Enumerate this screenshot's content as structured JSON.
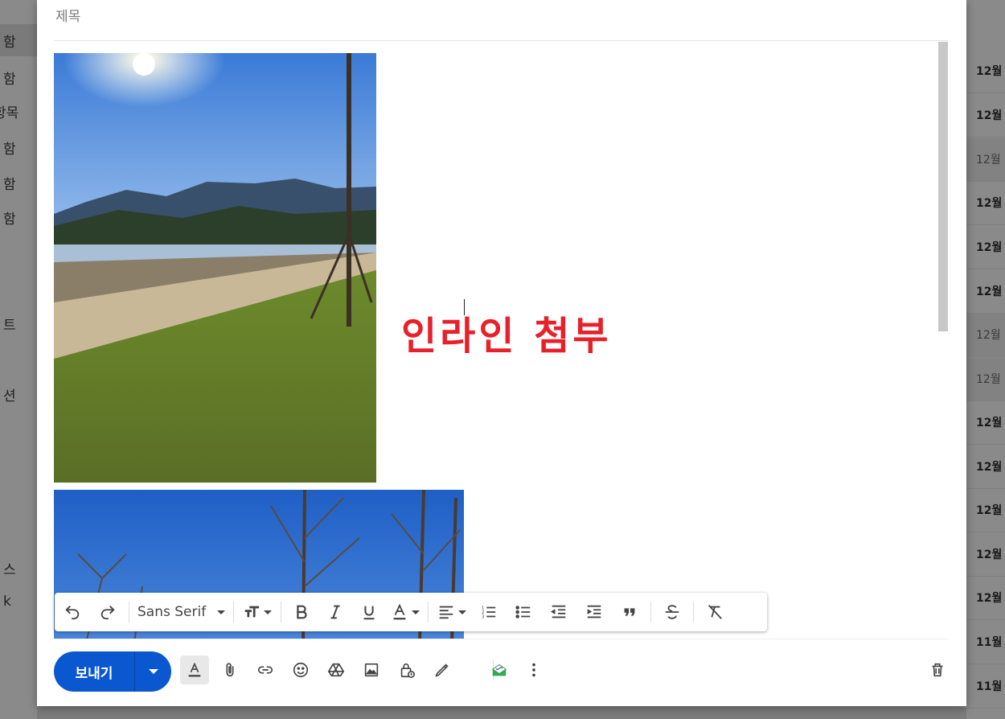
{
  "background": {
    "left_labels": [
      "함",
      "함",
      "항목",
      "함",
      "함",
      "함",
      "트",
      "션",
      "스",
      "k"
    ],
    "right_dates": [
      "12월",
      "12월",
      "12월",
      "12월",
      "12월",
      "12월",
      "12월",
      "12월",
      "12월",
      "12월",
      "12월",
      "12월",
      "12월",
      "11월",
      "11월"
    ]
  },
  "compose": {
    "subject_placeholder": "제목",
    "inline_text": "인라인 첨부",
    "inline_text_color": "#e8202a",
    "photos": [
      "photo-lakeside-mountains",
      "photo-bare-trees-blue-sky"
    ]
  },
  "format_toolbar": {
    "font_name": "Sans Serif",
    "icons": [
      "undo-icon",
      "redo-icon",
      "font-size-icon",
      "bold-icon",
      "italic-icon",
      "underline-icon",
      "text-color-icon",
      "align-icon",
      "numbered-list-icon",
      "bulleted-list-icon",
      "indent-less-icon",
      "indent-more-icon",
      "quote-icon",
      "strikethrough-icon",
      "remove-formatting-icon"
    ]
  },
  "actions": {
    "send_label": "보내기",
    "send_color": "#0b57d0",
    "icons": [
      "formatting-options-icon",
      "attach-file-icon",
      "insert-link-icon",
      "emoji-icon",
      "google-drive-icon",
      "insert-photo-icon",
      "confidential-mode-icon",
      "signature-icon",
      "addon-icon",
      "more-options-icon",
      "discard-draft-icon"
    ]
  }
}
